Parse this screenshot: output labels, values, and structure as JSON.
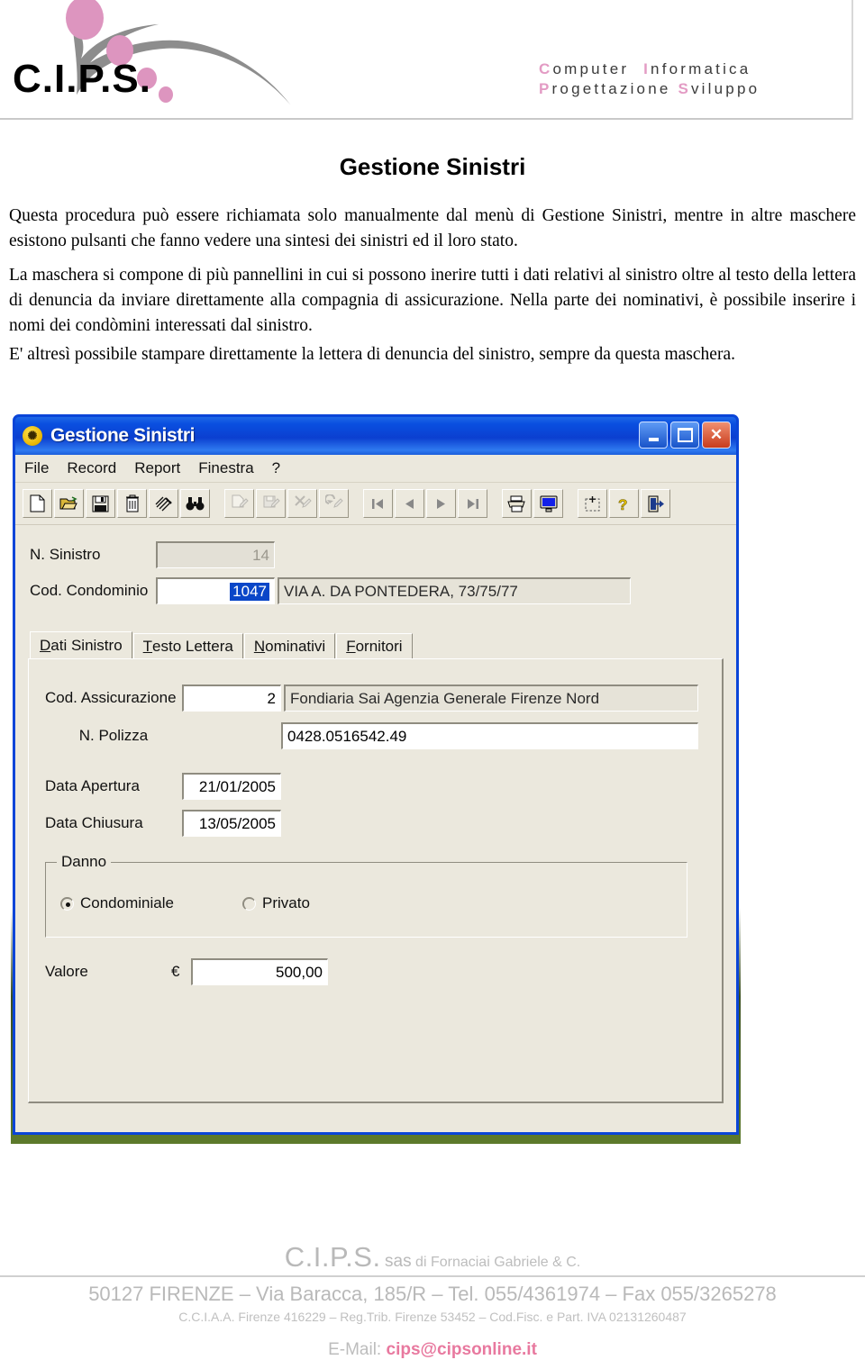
{
  "letterhead": {
    "logo_text": "C.I.P.S.",
    "tagline_line1": "Computer Informatica",
    "tagline_line2": "Progettazione Sviluppo"
  },
  "document": {
    "title": "Gestione Sinistri",
    "paragraph1": "Questa procedura può essere richiamata solo manualmente dal menù di Gestione Sinistri, mentre in altre maschere esistono pulsanti che fanno vedere una sintesi dei sinistri ed il loro stato.",
    "paragraph2": "La maschera si compone di più pannellini  in cui si possono inerire tutti i dati relativi al sinistro oltre al testo della lettera di denuncia da inviare direttamente alla compagnia di assicurazione. Nella parte dei nominativi, è possibile inserire i nomi dei condòmini interessati dal sinistro.",
    "paragraph3": "E' altresì possibile stampare direttamente la lettera di denuncia del sinistro, sempre da questa maschera."
  },
  "app_window": {
    "title": "Gestione Sinistri",
    "icon_glyph": "✺",
    "window_buttons": {
      "minimize": "_",
      "maximize": "□",
      "close": "×"
    },
    "menu": [
      "File",
      "Record",
      "Report",
      "Finestra",
      "?"
    ],
    "toolbar": {
      "groups": [
        [
          "new-document-icon",
          "open-folder-icon",
          "save-disk-icon",
          "delete-trash-icon",
          "clear-filter-icon",
          "find-binoculars-icon"
        ],
        [
          "new-record-icon",
          "save-record-icon",
          "cancel-edit-icon",
          "undo-icon"
        ],
        [
          "first-record-icon",
          "previous-record-icon",
          "next-record-icon",
          "last-record-icon"
        ],
        [
          "print-icon",
          "preview-monitor-icon"
        ],
        [
          "select-area-icon",
          "help-question-icon",
          "exit-door-icon"
        ]
      ]
    },
    "header_fields": [
      {
        "label": "N. Sinistro",
        "value": "14",
        "readonly": true
      },
      {
        "label": "Cod. Condominio",
        "value": "1047",
        "description": "VIA A. DA PONTEDERA, 73/75/77",
        "readonly": false
      }
    ],
    "tabs": [
      {
        "label": "Dati Sinistro",
        "accel": "D",
        "rest": "ati Sinistro",
        "active": true
      },
      {
        "label": "Testo Lettera",
        "accel": "T",
        "rest": "esto Lettera",
        "active": false
      },
      {
        "label": "Nominativi",
        "accel": "N",
        "rest": "ominativi",
        "active": false
      },
      {
        "label": "Fornitori",
        "accel": "F",
        "rest": "ornitori",
        "active": false
      }
    ],
    "dati_sinistro": {
      "cod_assicurazione_label": "Cod. Assicurazione",
      "cod_assicurazione_value": "2",
      "assicurazione_nome": "Fondiaria Sai Agenzia Generale Firenze Nord",
      "n_polizza_label": "N. Polizza",
      "n_polizza_value": "0428.0516542.49",
      "data_apertura_label": "Data Apertura",
      "data_apertura_value": "21/01/2005",
      "data_chiusura_label": "Data Chiusura",
      "data_chiusura_value": "13/05/2005",
      "danno_group_label": "Danno",
      "danno_options": [
        {
          "label": "Condominiale",
          "selected": true
        },
        {
          "label": "Privato",
          "selected": false
        }
      ],
      "valore_label": "Valore",
      "valore_currency": "€",
      "valore_value": "500,00"
    }
  },
  "footer": {
    "company_big": "C.I.P.S.",
    "company_mid": "sas",
    "company_small": "di Fornaciai Gabriele & C.",
    "address": "50127 FIRENZE – Via Baracca, 185/R – Tel. 055/4361974 – Fax 055/3265278",
    "registration": "C.C.I.A.A. Firenze 416229 – Reg.Trib. Firenze 53452 – Cod.Fisc. e Part. IVA 02131260487",
    "email_label": "E-Mail:",
    "email_value": "cips@cipsonline.it"
  },
  "colors": {
    "accent_pink": "#e39bc4",
    "titlebar_blue": "#0a45d8",
    "window_face": "#ebe8dd",
    "selection_blue": "#0a46c8",
    "footer_gray": "#b9b9b9"
  }
}
